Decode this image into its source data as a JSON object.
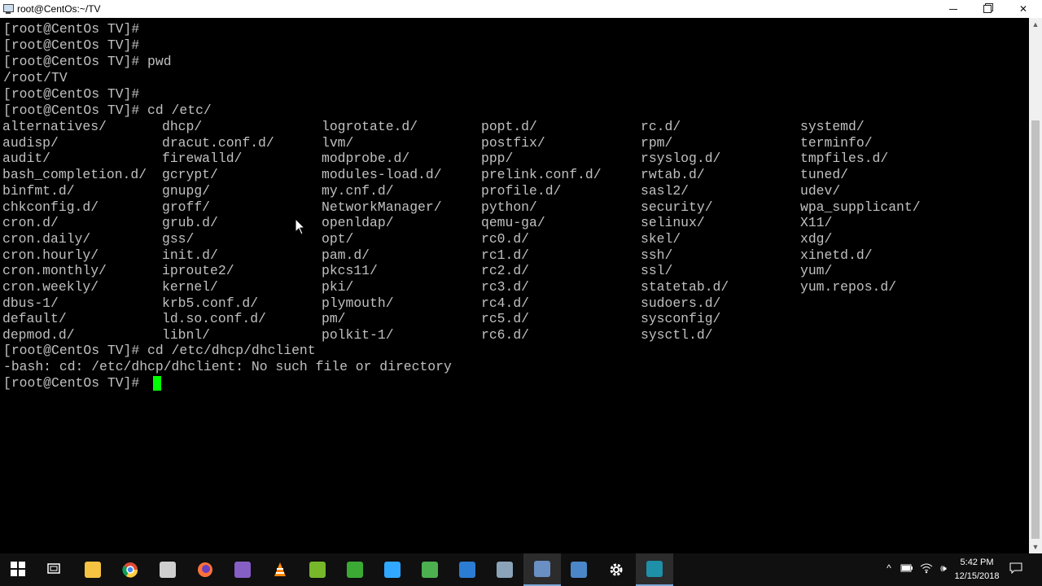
{
  "window": {
    "title": "root@CentOs:~/TV",
    "minimize_glyph": "",
    "close_glyph": "✕"
  },
  "terminal": {
    "lines_top": [
      "[root@CentOs TV]#",
      "[root@CentOs TV]#",
      "[root@CentOs TV]# pwd",
      "/root/TV",
      "[root@CentOs TV]#",
      "[root@CentOs TV]# cd /etc/"
    ],
    "listing_columns": [
      [
        "alternatives/",
        "audisp/",
        "audit/",
        "bash_completion.d/",
        "binfmt.d/",
        "chkconfig.d/",
        "cron.d/",
        "cron.daily/",
        "cron.hourly/",
        "cron.monthly/",
        "cron.weekly/",
        "dbus-1/",
        "default/",
        "depmod.d/"
      ],
      [
        "dhcp/",
        "dracut.conf.d/",
        "firewalld/",
        "gcrypt/",
        "gnupg/",
        "groff/",
        "grub.d/",
        "gss/",
        "init.d/",
        "iproute2/",
        "kernel/",
        "krb5.conf.d/",
        "ld.so.conf.d/",
        "libnl/"
      ],
      [
        "logrotate.d/",
        "lvm/",
        "modprobe.d/",
        "modules-load.d/",
        "my.cnf.d/",
        "NetworkManager/",
        "openldap/",
        "opt/",
        "pam.d/",
        "pkcs11/",
        "pki/",
        "plymouth/",
        "pm/",
        "polkit-1/"
      ],
      [
        "popt.d/",
        "postfix/",
        "ppp/",
        "prelink.conf.d/",
        "profile.d/",
        "python/",
        "qemu-ga/",
        "rc0.d/",
        "rc1.d/",
        "rc2.d/",
        "rc3.d/",
        "rc4.d/",
        "rc5.d/",
        "rc6.d/"
      ],
      [
        "rc.d/",
        "rpm/",
        "rsyslog.d/",
        "rwtab.d/",
        "sasl2/",
        "security/",
        "selinux/",
        "skel/",
        "ssh/",
        "ssl/",
        "statetab.d/",
        "sudoers.d/",
        "sysconfig/",
        "sysctl.d/"
      ],
      [
        "systemd/",
        "terminfo/",
        "tmpfiles.d/",
        "tuned/",
        "udev/",
        "wpa_supplicant/",
        "X11/",
        "xdg/",
        "xinetd.d/",
        "yum/",
        "yum.repos.d/"
      ]
    ],
    "lines_bottom": [
      "[root@CentOs TV]# cd /etc/dhcp/dhclient",
      "-bash: cd: /etc/dhcp/dhclient: No such file or directory",
      "[root@CentOs TV]# "
    ]
  },
  "taskbar": {
    "items": [
      {
        "name": "start-icon",
        "color": "#ffffff"
      },
      {
        "name": "task-view-icon",
        "color": "#ffffff"
      },
      {
        "name": "file-explorer-icon",
        "color": "#f5c342"
      },
      {
        "name": "chrome-icon",
        "color": "#dd4b39"
      },
      {
        "name": "feather-icon",
        "color": "#cfcfcf"
      },
      {
        "name": "firefox-icon",
        "color": "#ff7139"
      },
      {
        "name": "visual-studio-icon",
        "color": "#865fc5"
      },
      {
        "name": "vlc-icon",
        "color": "#ff8800"
      },
      {
        "name": "utorrent-icon",
        "color": "#76b82a"
      },
      {
        "name": "green-app-icon",
        "color": "#3aaa35"
      },
      {
        "name": "photoshop-icon",
        "color": "#31a8ff"
      },
      {
        "name": "notepad-icon",
        "color": "#4caf50"
      },
      {
        "name": "remote-desktop-icon",
        "color": "#2b7cd3"
      },
      {
        "name": "network-tool-icon",
        "color": "#8aa3b8"
      },
      {
        "name": "putty-icon",
        "color": "#6a8fc4"
      },
      {
        "name": "virtualbox-icon",
        "color": "#4a86c8"
      },
      {
        "name": "settings-gear-icon",
        "color": "#ffffff"
      },
      {
        "name": "terminal-app-icon",
        "color": "#1e90a8"
      }
    ],
    "clock": {
      "time": "5:42 PM",
      "date": "12/15/2018"
    },
    "tray": {
      "chevron": "^",
      "volume": "🕪"
    }
  },
  "colors": {
    "terminal_fg": "#c0c0c0",
    "terminal_bg": "#000000",
    "cursor": "#00ff00",
    "taskbar_bg": "#101010"
  }
}
